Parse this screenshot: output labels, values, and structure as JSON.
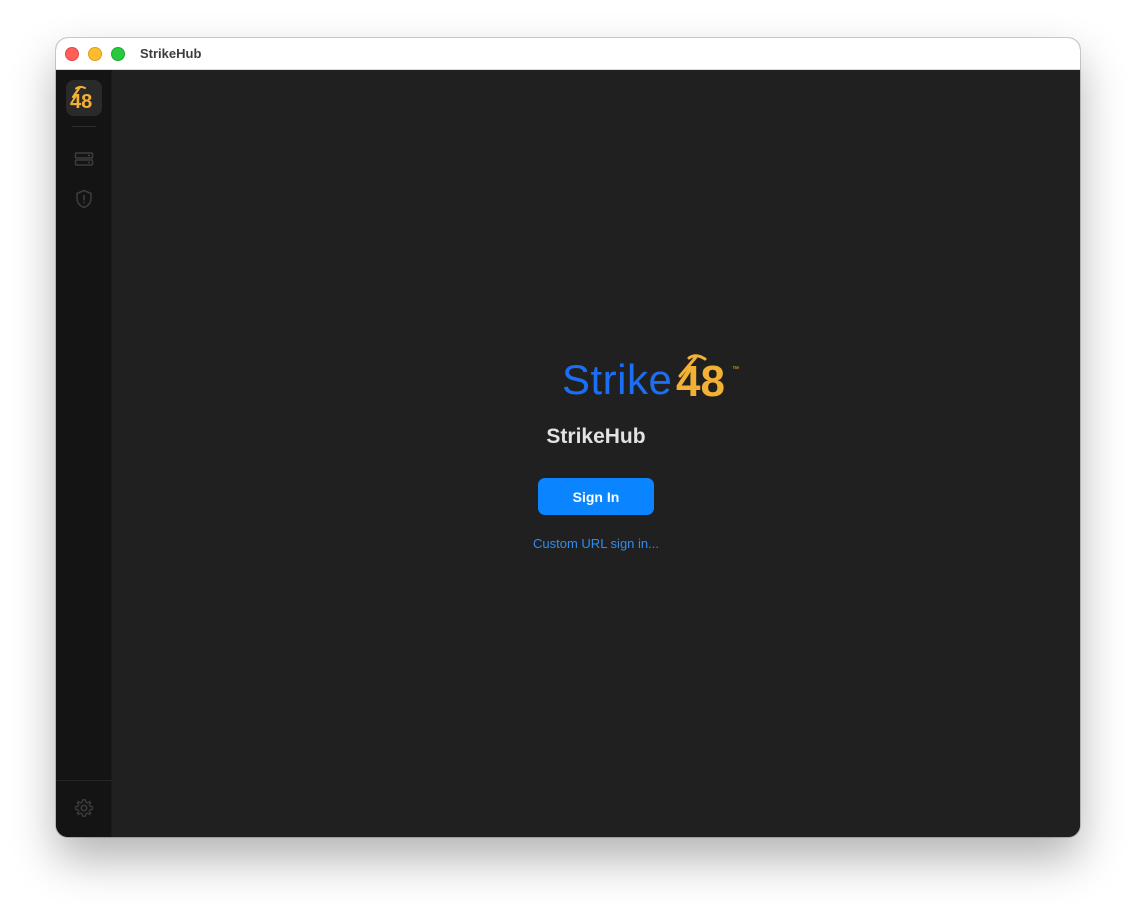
{
  "window": {
    "title": "StrikeHub"
  },
  "sidebar": {
    "logo_text": "48",
    "items": [
      {
        "name": "servers",
        "icon": "server-icon"
      },
      {
        "name": "security",
        "icon": "shield-icon"
      }
    ],
    "settings_icon": "gear-icon"
  },
  "main": {
    "brand_word": "Strike",
    "brand_number": "48",
    "brand_tm": "™",
    "app_name": "StrikeHub",
    "signin_label": "Sign In",
    "custom_url_label": "Custom URL sign in..."
  },
  "colors": {
    "accent_blue": "#0a84ff",
    "brand_blue": "#1a6ff5",
    "brand_orange": "#f2b134",
    "background": "#202020",
    "sidebar": "#141414"
  }
}
